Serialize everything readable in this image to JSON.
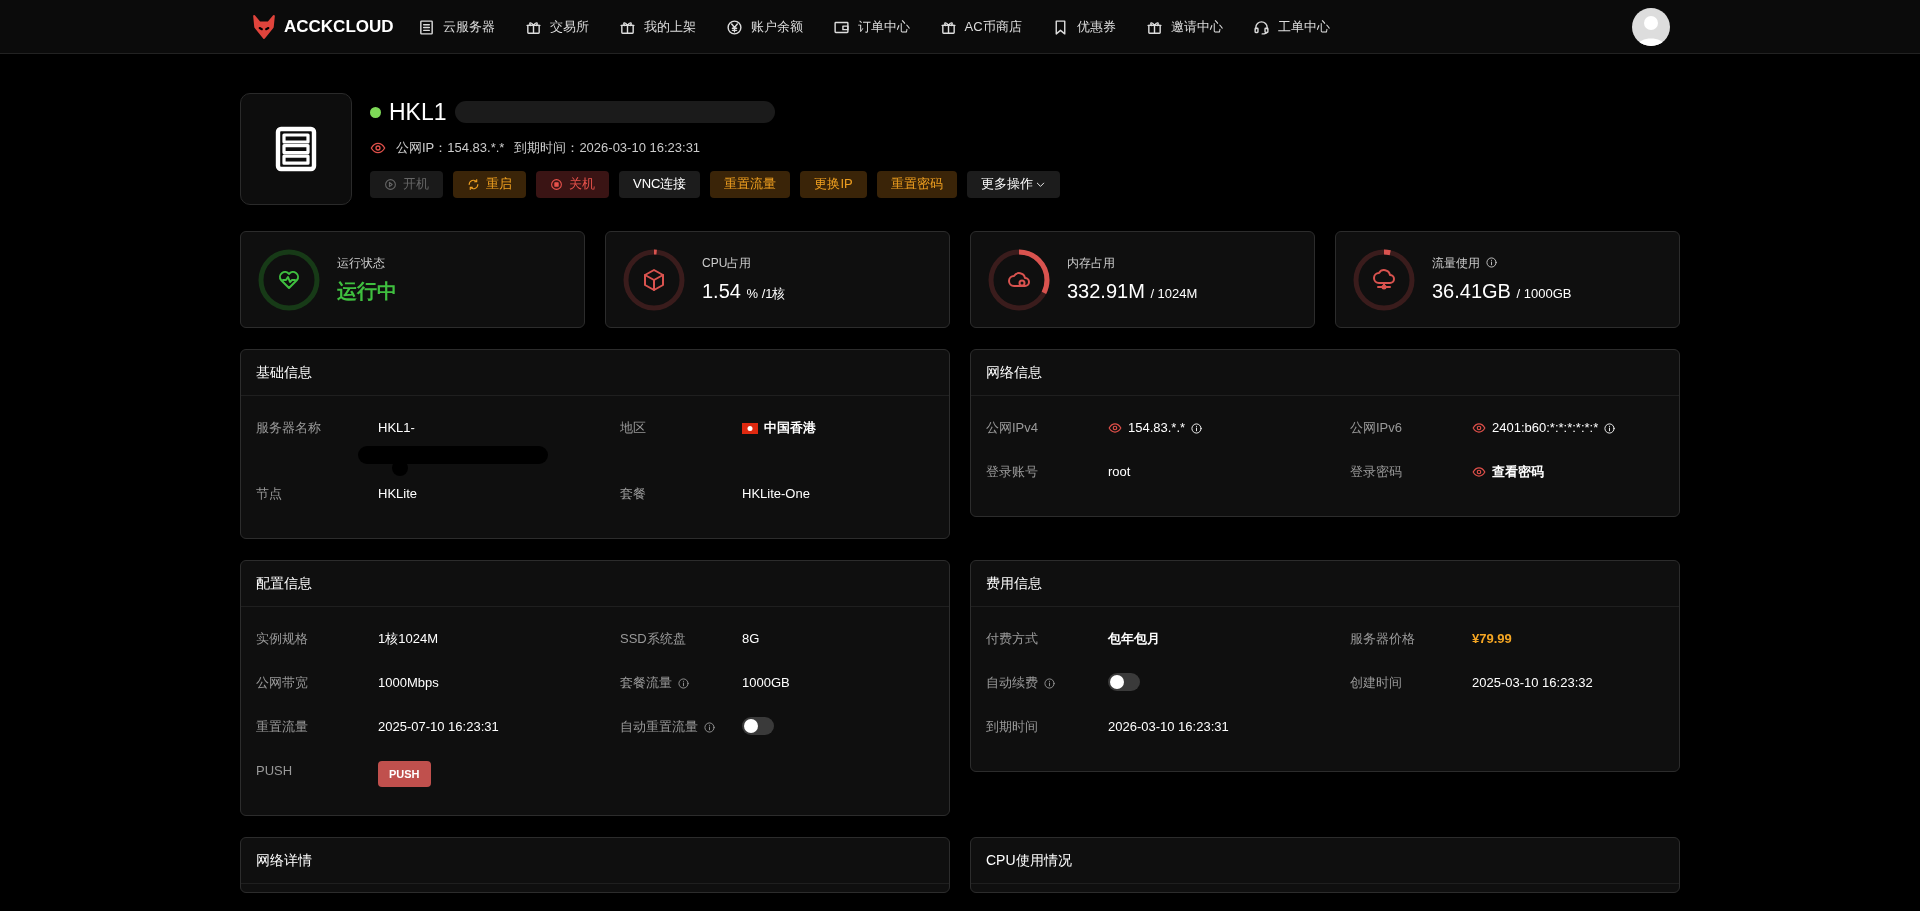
{
  "navbar": {
    "brand": "ACCKCLOUD",
    "items": [
      {
        "label": "云服务器",
        "kind": "list"
      },
      {
        "label": "交易所",
        "kind": "gift"
      },
      {
        "label": "我的上架",
        "kind": "gift"
      },
      {
        "label": "账户余额",
        "kind": "coin"
      },
      {
        "label": "订单中心",
        "kind": "wallet"
      },
      {
        "label": "AC币商店",
        "kind": "gift"
      },
      {
        "label": "优惠券",
        "kind": "bookmark"
      },
      {
        "label": "邀请中心",
        "kind": "gift"
      },
      {
        "label": "工单中心",
        "kind": "headset"
      }
    ]
  },
  "server": {
    "online": true,
    "name": "HKL1",
    "name_redacted": true,
    "ip": "公网IP：154.83.*.*",
    "expiry": "到期时间：2026-03-10 16:23:31",
    "buttons": [
      {
        "label": "开机",
        "kind": "start",
        "disabled": true
      },
      {
        "label": "重启",
        "kind": "restart",
        "disabled": false
      },
      {
        "label": "关机",
        "kind": "stop",
        "disabled": false
      },
      {
        "label": "VNC连接",
        "kind": "plain",
        "disabled": false
      },
      {
        "label": "重置流量",
        "kind": "warning",
        "disabled": false
      },
      {
        "label": "更换IP",
        "kind": "warning",
        "disabled": false
      },
      {
        "label": "重置密码",
        "kind": "warning",
        "disabled": false
      },
      {
        "label": "更多操作",
        "kind": "menu",
        "disabled": false
      }
    ]
  },
  "stats": [
    {
      "kind": "status",
      "label": "运行状态",
      "value": "运行中",
      "running": true,
      "info": false
    },
    {
      "kind": "gauge",
      "label": "CPU占用",
      "value": "1.54",
      "unit": "% /1核",
      "level": 0.0154,
      "info": false
    },
    {
      "kind": "gauge",
      "label": "内存占用",
      "value": "332.91M",
      "unit": "/ 1024M",
      "level": 0.325,
      "info": false
    },
    {
      "kind": "gauge",
      "label": "流量使用",
      "value": "36.41GB",
      "unit": "/ 1000GB",
      "level": 0.036,
      "info": true
    }
  ],
  "panels": [
    {
      "title": "基础信息",
      "fields": [
        {
          "label": "服务器名称",
          "value": "HKL1-",
          "kind": "text",
          "info": false,
          "redacted": true
        },
        {
          "label": "地区",
          "value": "中国香港",
          "kind": "region",
          "info": false
        },
        {
          "label": "节点",
          "value": "HKLite",
          "kind": "text",
          "info": false
        },
        {
          "label": "套餐",
          "value": "HKLite-One",
          "kind": "text",
          "info": false
        }
      ]
    },
    {
      "title": "网络信息",
      "fields": [
        {
          "label": "公网IPv4",
          "value": "154.83.*.*",
          "kind": "text",
          "info": true,
          "masked": true
        },
        {
          "label": "公网IPv6",
          "value": "2401:b60:*:*:*:*:*:*",
          "kind": "text",
          "info": true,
          "masked": true
        },
        {
          "label": "登录账号",
          "value": "root",
          "kind": "text",
          "info": false,
          "masked": false
        },
        {
          "label": "登录密码",
          "value": "查看密码",
          "kind": "strong",
          "info": false,
          "masked": true
        }
      ]
    },
    {
      "title": "配置信息",
      "fields": [
        {
          "label": "实例规格",
          "value": "1核1024M",
          "kind": "text",
          "info": false
        },
        {
          "label": "SSD系统盘",
          "value": "8G",
          "kind": "text",
          "info": false
        },
        {
          "label": "公网带宽",
          "value": "1000Mbps",
          "kind": "text",
          "info": false
        },
        {
          "label": "套餐流量",
          "value": "1000GB",
          "kind": "text",
          "info": true
        },
        {
          "label": "重置流量",
          "value": "2025-07-10 16:23:31",
          "kind": "text",
          "info": false
        },
        {
          "label": "自动重置流量",
          "kind": "toggle",
          "on": false,
          "info": true
        },
        {
          "label": "PUSH",
          "value": "PUSH",
          "kind": "badge",
          "info": false
        }
      ]
    },
    {
      "title": "费用信息",
      "fields": [
        {
          "label": "付费方式",
          "value": "包年包月",
          "kind": "strong",
          "info": false
        },
        {
          "label": "服务器价格",
          "value": "¥79.99",
          "kind": "price",
          "info": false
        },
        {
          "label": "自动续费",
          "kind": "toggle",
          "on": false,
          "info": true
        },
        {
          "label": "创建时间",
          "value": "2025-03-10 16:23:32",
          "kind": "text",
          "info": false
        },
        {
          "label": "到期时间",
          "value": "2026-03-10 16:23:31",
          "kind": "text",
          "info": false
        }
      ]
    },
    {
      "title": "网络详情"
    },
    {
      "title": "CPU使用情况"
    }
  ]
}
